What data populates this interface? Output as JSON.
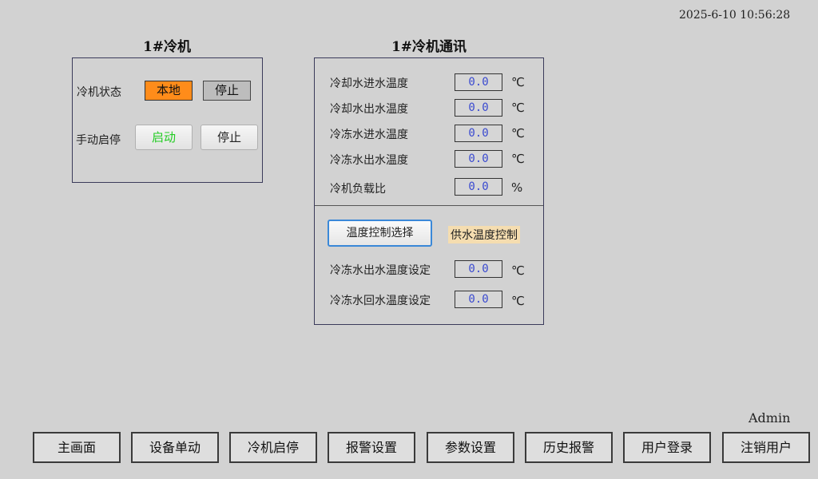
{
  "clock": "2025-6-10 10:56:28",
  "chiller_panel": {
    "title": "1#冷机",
    "status_label": "冷机状态",
    "status_local": "本地",
    "status_stop": "停止",
    "manual_label": "手动启停",
    "start_button": "启动",
    "stop_button": "停止"
  },
  "comm_panel": {
    "title": "1#冷机通讯",
    "rows": [
      {
        "label": "冷却水进水温度",
        "value": "0.0",
        "unit": "℃"
      },
      {
        "label": "冷却水出水温度",
        "value": "0.0",
        "unit": "℃"
      },
      {
        "label": "冷冻水进水温度",
        "value": "0.0",
        "unit": "℃"
      },
      {
        "label": "冷冻水出水温度",
        "value": "0.0",
        "unit": "℃"
      },
      {
        "label": "冷机负载比",
        "value": "0.0",
        "unit": "%"
      }
    ],
    "temp_control_button": "温度控制选择",
    "temp_control_mode": "供水温度控制",
    "setpoints": [
      {
        "label": "冷冻水出水温度设定",
        "value": "0.0",
        "unit": "℃"
      },
      {
        "label": "冷冻水回水温度设定",
        "value": "0.0",
        "unit": "℃"
      }
    ]
  },
  "user": "Admin",
  "nav": [
    "主画面",
    "设备单动",
    "冷机启停",
    "报警设置",
    "参数设置",
    "历史报警",
    "用户登录",
    "注销用户"
  ],
  "colors": {
    "background": "#d2d2d2",
    "local_status": "#ff8c1a",
    "start_text": "#22cc22",
    "value_text": "#3a4ad0",
    "mode_tag": "#f5ddb0",
    "select_border": "#3a88d8"
  }
}
